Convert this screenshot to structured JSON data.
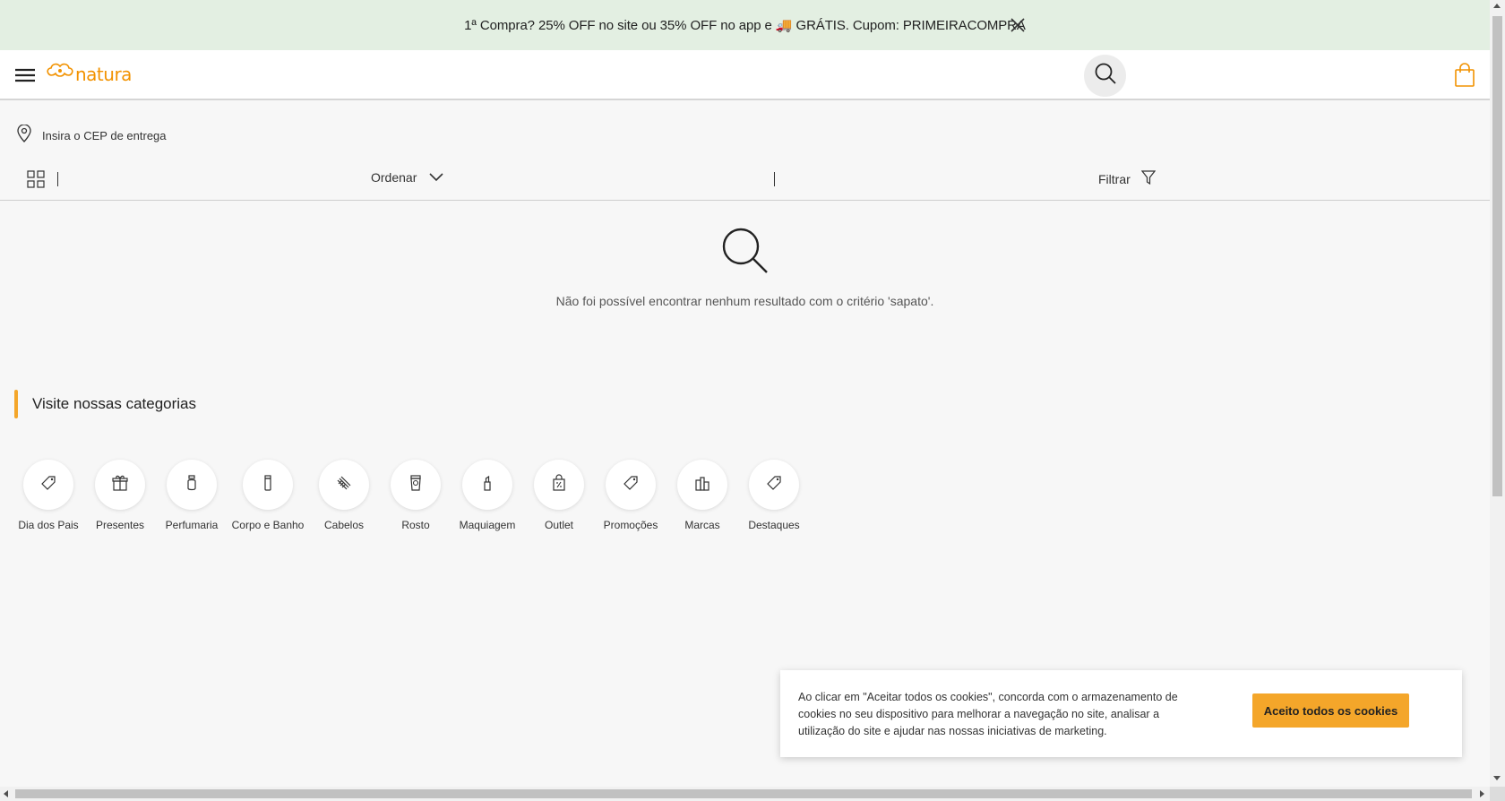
{
  "promo": {
    "text": "1ª Compra? 25% OFF no site ou 35% OFF no app e 🚚 GRÁTIS. Cupom: PRIMEIRACOMPRA",
    "background": "#e3efe2"
  },
  "header": {
    "logo_text": "natura",
    "brand_color": "#f29200",
    "icons": [
      "menu-icon",
      "natura-logo-icon",
      "search-icon",
      "shopping-bag-icon"
    ]
  },
  "cep": {
    "label": "Insira o CEP de entrega",
    "icon": "location-pin-icon"
  },
  "toolbar": {
    "order_label": "Ordenar",
    "filter_label": "Filtrar",
    "icons": [
      "grid-view-icon",
      "chevron-down-icon",
      "filter-icon"
    ]
  },
  "empty_state": {
    "message": "Não foi possível encontrar nenhum resultado com o critério 'sapato'.",
    "icon": "search-icon"
  },
  "categories": {
    "title": "Visite nossas categorias",
    "accent": "#f4a62a",
    "items": [
      {
        "label": "Dia dos Pais",
        "icon": "tag-icon"
      },
      {
        "label": "Presentes",
        "icon": "gift-icon"
      },
      {
        "label": "Perfumaria",
        "icon": "perfume-icon"
      },
      {
        "label": "Corpo e Banho",
        "icon": "bottle-icon"
      },
      {
        "label": "Cabelos",
        "icon": "comb-icon"
      },
      {
        "label": "Rosto",
        "icon": "face-cream-icon"
      },
      {
        "label": "Maquiagem",
        "icon": "lipstick-icon"
      },
      {
        "label": "Outlet",
        "icon": "discount-bag-icon"
      },
      {
        "label": "Promoções",
        "icon": "tag-icon"
      },
      {
        "label": "Marcas",
        "icon": "products-icon"
      },
      {
        "label": "Destaques",
        "icon": "tag-icon"
      }
    ]
  },
  "cookie": {
    "text": "Ao clicar em \"Aceitar todos os cookies\", concorda com o armazenamento de cookies no seu dispositivo para melhorar a navegação no site, analisar a utilização do site e ajudar nas nossas iniciativas de marketing.",
    "button_label": "Aceito todos os cookies",
    "button_color": "#f4a62a"
  }
}
